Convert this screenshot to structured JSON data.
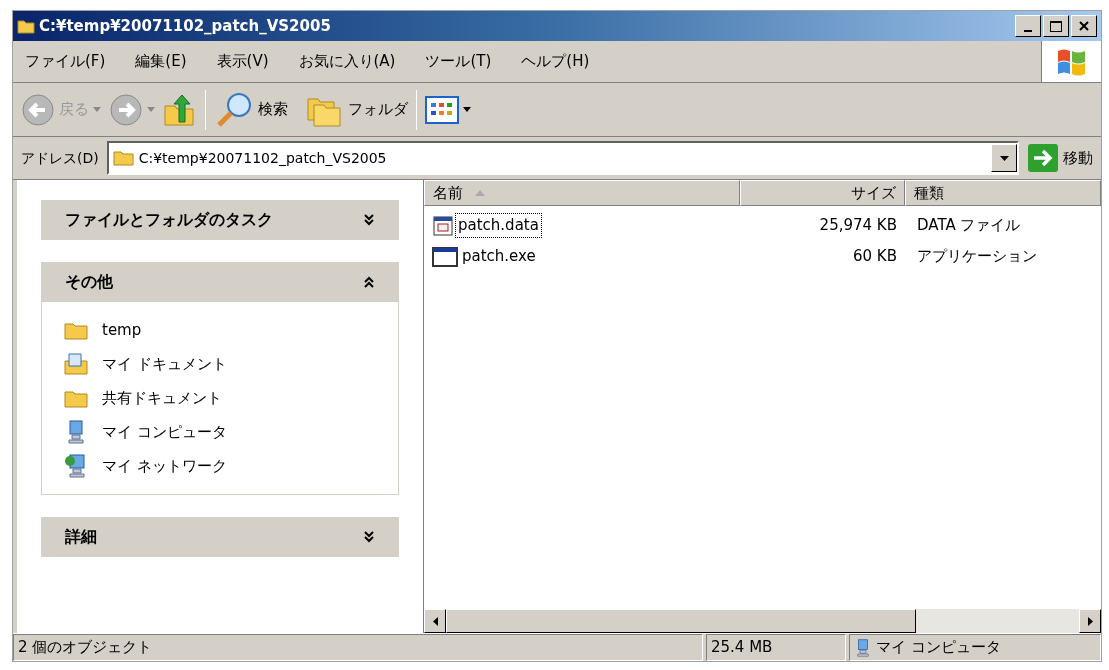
{
  "window": {
    "title": "C:¥temp¥20071102_patch_VS2005"
  },
  "menu": [
    "ファイル(F)",
    "編集(E)",
    "表示(V)",
    "お気に入り(A)",
    "ツール(T)",
    "ヘルプ(H)"
  ],
  "toolbar": {
    "back": {
      "label": "戻る",
      "disabled": true
    },
    "forward": {
      "disabled": true
    },
    "search": "検索",
    "folders": "フォルダ"
  },
  "address": {
    "label": "アドレス(D)",
    "value": "C:¥temp¥20071102_patch_VS2005",
    "go": "移動"
  },
  "task_panels": [
    {
      "title": "ファイルとフォルダのタスク",
      "expanded": false
    },
    {
      "title": "その他",
      "expanded": true,
      "items": [
        {
          "kind": "folder",
          "label": "temp"
        },
        {
          "kind": "documents",
          "label": "マイ ドキュメント"
        },
        {
          "kind": "folder",
          "label": "共有ドキュメント"
        },
        {
          "kind": "computer",
          "label": "マイ コンピュータ"
        },
        {
          "kind": "network",
          "label": "マイ ネットワーク"
        }
      ]
    },
    {
      "title": "詳細",
      "expanded": false
    }
  ],
  "table": {
    "columns": [
      "名前",
      "サイズ",
      "種類"
    ],
    "rows": [
      {
        "kind": "data",
        "name": "patch.data",
        "size": "25,974 KB",
        "type": "DATA ファイル",
        "focused": true
      },
      {
        "kind": "exe",
        "name": "patch.exe",
        "size": "60 KB",
        "type": "アプリケーション",
        "focused": false
      }
    ]
  },
  "status_bar": [
    "2 個のオブジェクト",
    "25.4 MB",
    "マイ コンピュータ"
  ]
}
